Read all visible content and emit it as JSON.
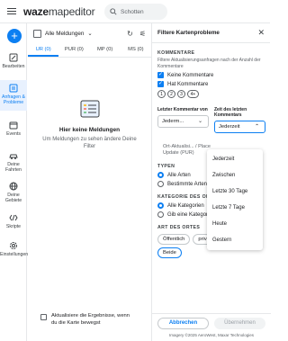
{
  "app": {
    "logo_bold": "waze",
    "logo_rest": "mapeditor"
  },
  "search": {
    "placeholder": "Schotten"
  },
  "rail": [
    {
      "label": "Bearbeiten",
      "icon": "edit-icon"
    },
    {
      "label": "Anfragen & Probleme",
      "icon": "list-icon",
      "active": true
    },
    {
      "label": "Events",
      "icon": "calendar-icon"
    },
    {
      "label": "Deine Fahrten",
      "icon": "car-icon"
    },
    {
      "label": "Deine Gebiete",
      "icon": "globe-icon"
    },
    {
      "label": "Skripte",
      "icon": "code-icon"
    },
    {
      "label": "Einstellungen",
      "icon": "gear-icon"
    }
  ],
  "middle": {
    "filter_label": "Alle Meldungen",
    "tabs": [
      "UR (0)",
      "PUR (0)",
      "MP (0)",
      "MS (0)"
    ],
    "empty_title": "Hier keine Meldungen",
    "empty_text": "Um Meldungen zu sehen ändere Deine Filter",
    "update_text": "Aktualisiere die Ergebnisse, wenn du die Karte bewegst"
  },
  "filter": {
    "title": "Filtere Kartenprobleme",
    "comments_title": "KOMMENTARE",
    "comments_desc": "Filtere Aktualisierungsanfragen nach der Anzahl der Kommentare",
    "opt_no_comments": "Keine Kommentare",
    "opt_has_comments": "Hat Kommentare",
    "counts": [
      "1",
      "2",
      "3",
      "4+"
    ],
    "last_comment_label": "Letzter Kommentar von",
    "last_comment_value": "Jederm...",
    "time_label": "Zeit des letzten Kommentars",
    "time_value": "Jederzeit",
    "behind_text": "Ort-Aktualisi... / Place Update (PUR)",
    "types_title": "TYPEN",
    "types_all": "Alle Arten",
    "types_some": "Bestimmte Arten",
    "category_title": "KATEGORIE DES ORTS",
    "cat_all": "Alle Kategorien",
    "cat_one": "Gib eine Kategorie ein",
    "place_type_title": "ART DES ORTES",
    "chips": [
      "Öffentlich",
      "private Wohnstätte",
      "Beide"
    ],
    "cancel": "Abbrechen",
    "apply": "Übernehmen",
    "credit": "Imagery ©2025 AeroWest, Maxar Technologies"
  },
  "dropdown": [
    "Jederzeit",
    "Zwischen",
    "Letzte 30 Tage",
    "Letzte 7 Tage",
    "Heute",
    "Gestern"
  ],
  "colors": {
    "accent": "#0c7ff2"
  }
}
